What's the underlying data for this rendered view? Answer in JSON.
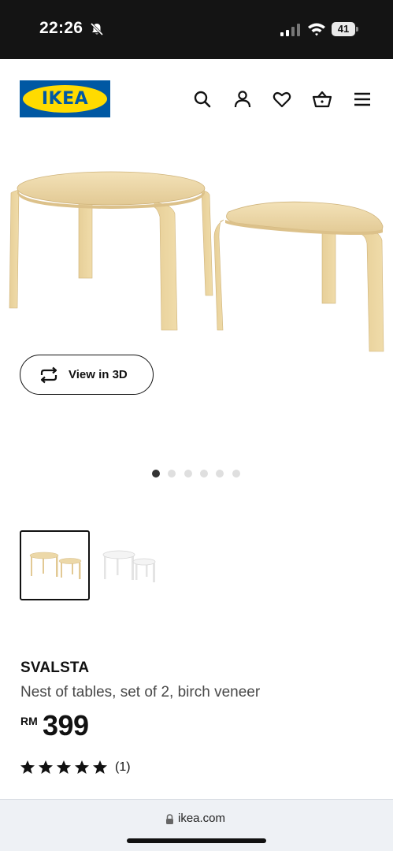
{
  "status_bar": {
    "time": "22:26",
    "battery": "41"
  },
  "header": {
    "logo_text": "IKEA"
  },
  "gallery": {
    "view_3d_label": "View in 3D",
    "slide_count": 6,
    "active_slide": 1
  },
  "product": {
    "name": "SVALSTA",
    "description": "Nest of tables, set of 2, birch veneer",
    "currency": "RM",
    "price": "399",
    "rating_stars": 5,
    "rating_count": "(1)"
  },
  "browser": {
    "url": "ikea.com"
  },
  "colors": {
    "brand_blue": "#0058a3",
    "brand_yellow": "#ffdb00",
    "birch": "#ecd8a8"
  }
}
